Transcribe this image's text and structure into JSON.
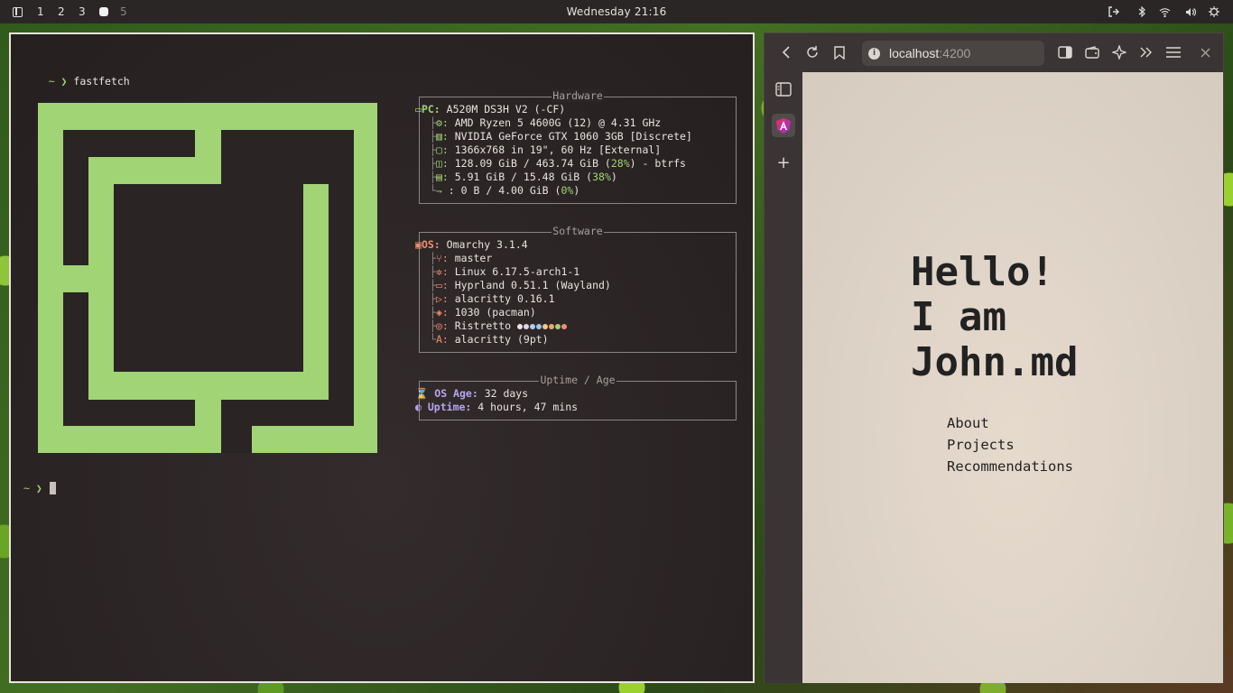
{
  "topbar": {
    "workspaces": [
      "1",
      "2",
      "3",
      "5"
    ],
    "clock": "Wednesday 21:16"
  },
  "terminal": {
    "prompt_symbol": "~ ❯",
    "command": "fastfetch",
    "hardware": {
      "title": "Hardware",
      "pc_key": "PC",
      "pc": "A520M DS3H V2 (-CF)",
      "cpu": "AMD Ryzen 5 4600G (12) @ 4.31 GHz",
      "gpu": "NVIDIA GeForce GTX 1060 3GB [Discrete]",
      "display": "1366x768 in 19\", 60 Hz [External]",
      "disk_used": "128.09 GiB / 463.74 GiB",
      "disk_pct": "28%",
      "disk_fs": "- btrfs",
      "mem_used": "5.91 GiB / 15.48 GiB",
      "mem_pct": "38%",
      "swap_used": "0 B / 4.00 GiB",
      "swap_pct": "0%"
    },
    "software": {
      "title": "Software",
      "os_key": "OS",
      "os": "Omarchy 3.1.4",
      "branch": "master",
      "kernel": "Linux 6.17.5-arch1-1",
      "wm": "Hyprland 0.51.1 (Wayland)",
      "terminal": "alacritty 0.16.1",
      "packages": "1030 (pacman)",
      "theme": "Ristretto",
      "font": "alacritty (9pt)"
    },
    "uptime": {
      "title": "Uptime / Age",
      "os_age_key": "OS Age",
      "os_age": "32 days",
      "uptime_key": "Uptime",
      "uptime": "4 hours, 47 mins"
    },
    "theme_colors": [
      "#e9e4df",
      "#d7d7f0",
      "#b6c9f0",
      "#9ac5f0",
      "#f0c98a",
      "#f0a86c",
      "#a0d475",
      "#f08d71"
    ]
  },
  "browser": {
    "url_host": "localhost",
    "url_port": ":4200",
    "page": {
      "heading": [
        "Hello!",
        "I am",
        "John.md"
      ],
      "nav": [
        "About",
        "Projects",
        "Recommendations"
      ]
    }
  },
  "colors": {
    "accent_green": "#a0d475",
    "accent_orange": "#f08d71",
    "accent_purple": "#b6a6f0"
  }
}
